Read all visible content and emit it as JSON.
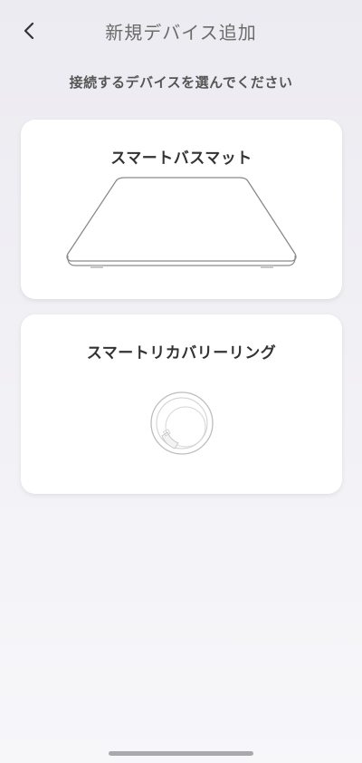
{
  "header": {
    "back_icon": "chevron-left-icon",
    "title": "新規デバイス追加"
  },
  "subtitle": "接続するデバイスを選んでください",
  "devices": [
    {
      "label": "スマートバスマット",
      "icon": "bath-mat-illustration"
    },
    {
      "label": "スマートリカバリーリング",
      "icon": "ring-illustration"
    }
  ],
  "colors": {
    "background": "#efeef3",
    "card": "#ffffff",
    "title_text": "#6b6b6b",
    "label_text": "#333333"
  }
}
